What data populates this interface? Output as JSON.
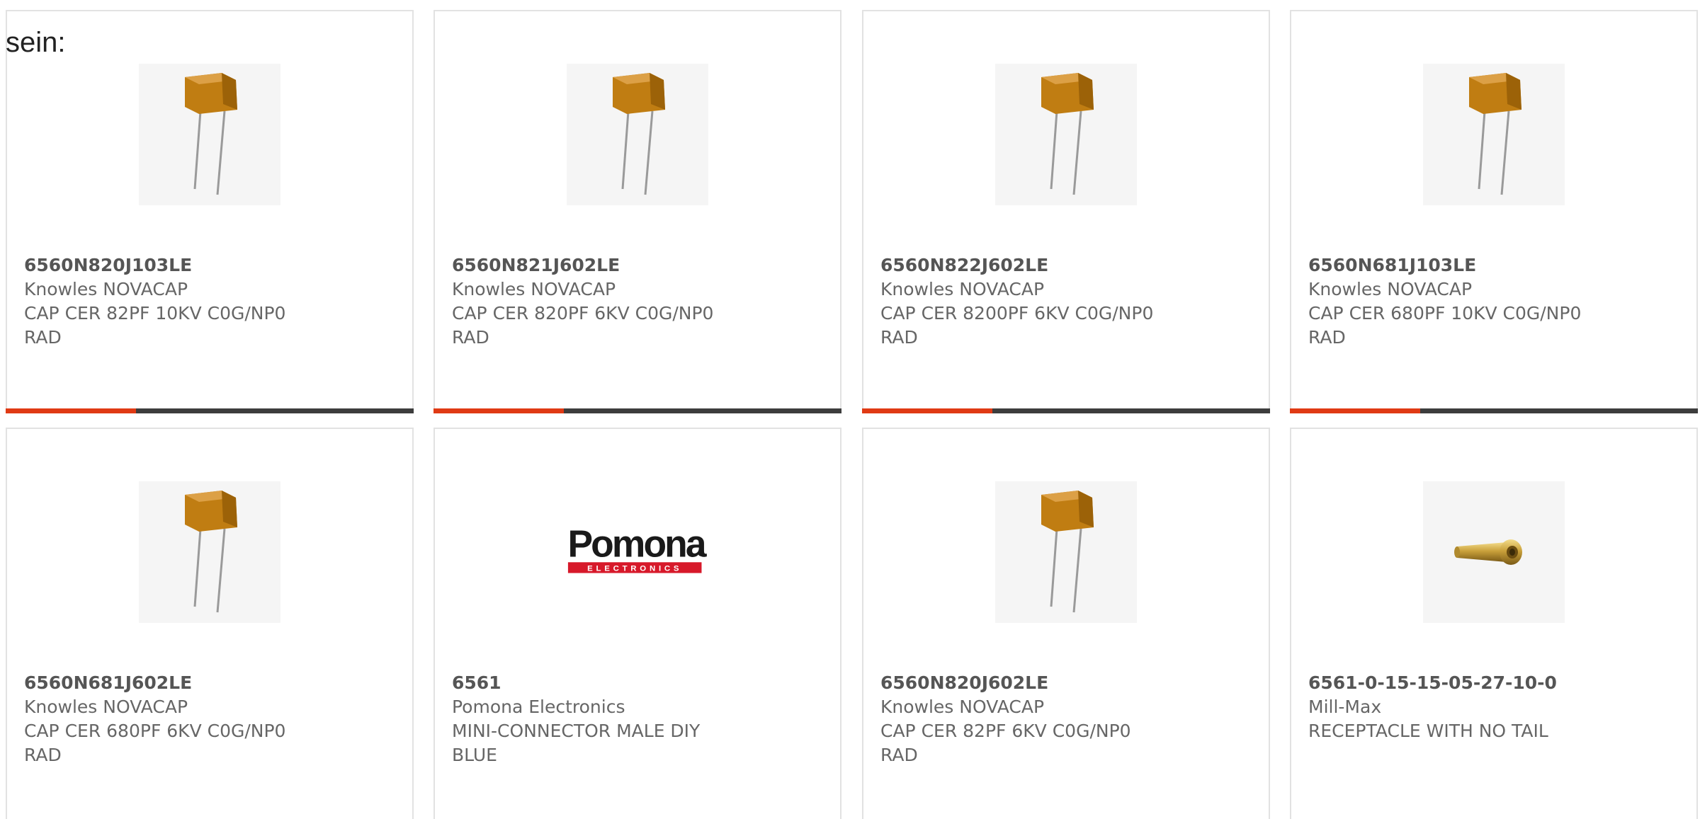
{
  "intro_text": "sein:",
  "colors": {
    "accent": "#e03a14",
    "bar_track": "#3d3d3d",
    "card_border": "#e2e2e2",
    "text_muted": "#666666"
  },
  "products": [
    {
      "part_number": "6560N820J103LE",
      "manufacturer": "Knowles NOVACAP",
      "description": "CAP CER 82PF 10KV C0G/NP0 RAD",
      "image": "ceramic-capacitor-icon",
      "progress": 0.32
    },
    {
      "part_number": "6560N821J602LE",
      "manufacturer": "Knowles NOVACAP",
      "description": "CAP CER 820PF 6KV C0G/NP0 RAD",
      "image": "ceramic-capacitor-icon",
      "progress": 0.32
    },
    {
      "part_number": "6560N822J602LE",
      "manufacturer": "Knowles NOVACAP",
      "description": "CAP CER 8200PF 6KV C0G/NP0 RAD",
      "image": "ceramic-capacitor-icon",
      "progress": 0.32
    },
    {
      "part_number": "6560N681J103LE",
      "manufacturer": "Knowles NOVACAP",
      "description": "CAP CER 680PF 10KV C0G/NP0 RAD",
      "image": "ceramic-capacitor-icon",
      "progress": 0.32
    },
    {
      "part_number": "6560N681J602LE",
      "manufacturer": "Knowles NOVACAP",
      "description": "CAP CER 680PF 6KV C0G/NP0 RAD",
      "image": "ceramic-capacitor-icon"
    },
    {
      "part_number": "6561",
      "manufacturer": "Pomona Electronics",
      "description": "MINI-CONNECTOR MALE DIY BLUE",
      "image": "pomona-logo",
      "logo_text": "Pomona",
      "logo_subtext": "ELECTRONICS"
    },
    {
      "part_number": "6560N820J602LE",
      "manufacturer": "Knowles NOVACAP",
      "description": "CAP CER 82PF 6KV C0G/NP0 RAD",
      "image": "ceramic-capacitor-icon"
    },
    {
      "part_number": "6561-0-15-15-05-27-10-0",
      "manufacturer": "Mill-Max",
      "description": "RECEPTACLE WITH NO TAIL",
      "image": "brass-receptacle-icon"
    }
  ]
}
